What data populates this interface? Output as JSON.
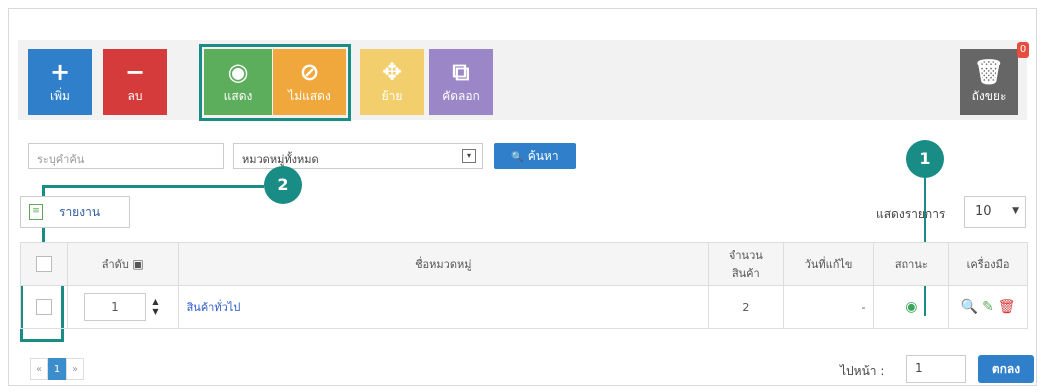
{
  "toolbar": {
    "add": {
      "label": "เพิ่ม",
      "icon": "+"
    },
    "delete": {
      "label": "ลบ",
      "icon": "−"
    },
    "show": {
      "label": "แสดง",
      "icon": "◉"
    },
    "hide": {
      "label": "ไม่แสดง",
      "icon": "⊘"
    },
    "move": {
      "label": "ย้าย",
      "icon": "✥"
    },
    "copy": {
      "label": "คัดลอก",
      "icon": "⧉"
    },
    "trash": {
      "label": "ถังขยะ",
      "icon": "🗑",
      "count": "0"
    }
  },
  "search": {
    "placeholder": "ระบุคำค้น",
    "category_value": "หมวดหมู่ทั้งหมด",
    "button_label": "ค้นหา",
    "button_icon": "🔍"
  },
  "annotations": {
    "one": "1",
    "two": "2"
  },
  "report": {
    "label": "รายงาน"
  },
  "perpage": {
    "label": "แสดงรายการ",
    "value": "10"
  },
  "table": {
    "headers": {
      "order": "ลำดับ",
      "name": "ชื่อหมวดหมู่",
      "count_line1": "จำนวน",
      "count_line2": "สินค้า",
      "modified": "วันที่แก้ไข",
      "status": "สถานะ",
      "tools": "เครื่องมือ"
    },
    "rows": [
      {
        "order": "1",
        "name": "สินค้าทั่วไป",
        "count": "2",
        "modified": "-",
        "status_icon": "◉"
      }
    ]
  },
  "pager": {
    "prev": "«",
    "current": "1",
    "next": "»"
  },
  "goto": {
    "label": "ไปหน้า :",
    "value": "1",
    "button": "ตกลง"
  },
  "colors": {
    "accent": "#1a8c86",
    "primary": "#2f7fcb"
  }
}
